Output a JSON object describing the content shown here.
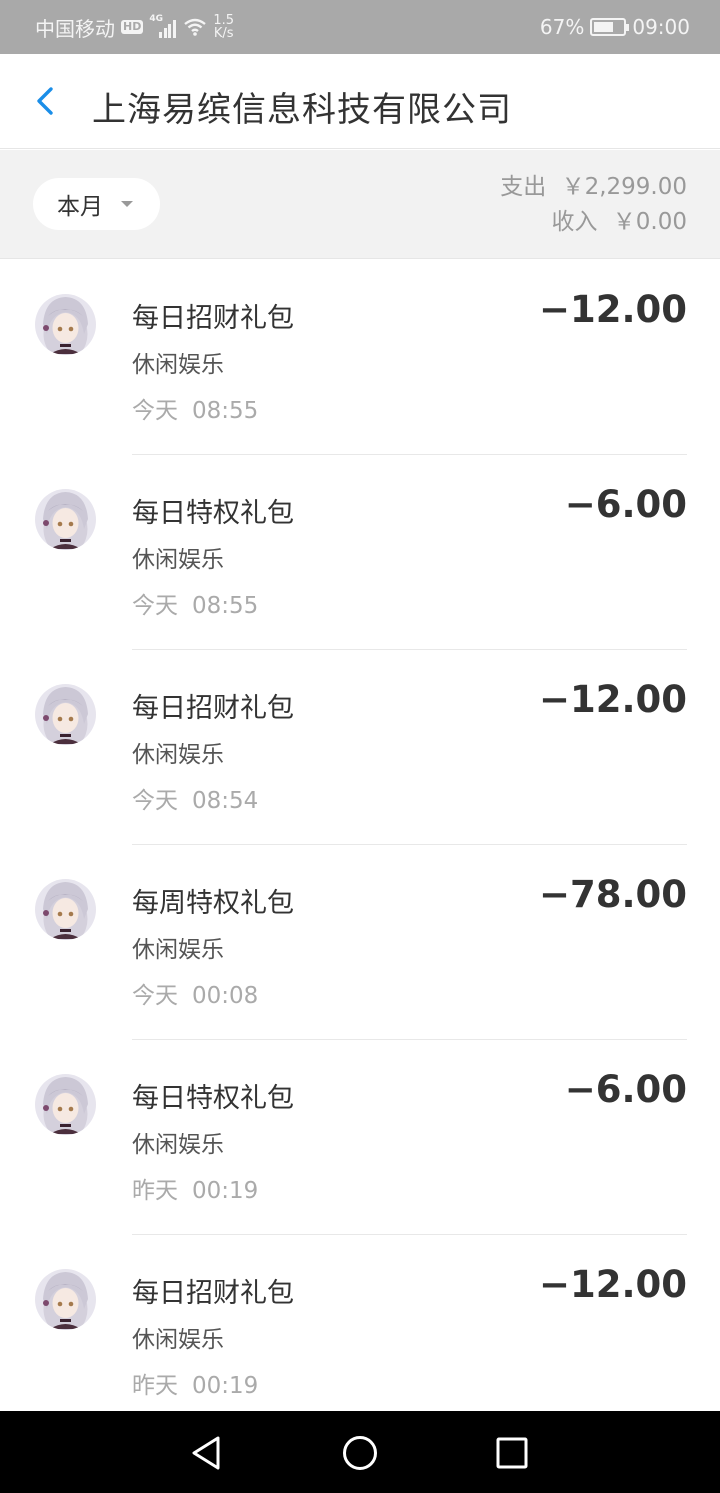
{
  "status_bar": {
    "carrier": "中国移动",
    "hd": "HD",
    "network": "4G",
    "speed_value": "1.5",
    "speed_unit": "K/s",
    "battery_percent": "67%",
    "battery_level": 0.67,
    "time": "09:00"
  },
  "header": {
    "title": "上海易缤信息科技有限公司",
    "back_icon": "chevron-left-icon",
    "accent_color": "#1a8ee8"
  },
  "filter": {
    "period_label": "本月",
    "expense_label": "支出",
    "expense_value": "￥2,299.00",
    "income_label": "收入",
    "income_value": "￥0.00"
  },
  "transactions": [
    {
      "title": "每日招财礼包",
      "category": "休闲娱乐",
      "day": "今天",
      "time": "08:55",
      "amount": "−12.00"
    },
    {
      "title": "每日特权礼包",
      "category": "休闲娱乐",
      "day": "今天",
      "time": "08:55",
      "amount": "−6.00"
    },
    {
      "title": "每日招财礼包",
      "category": "休闲娱乐",
      "day": "今天",
      "time": "08:54",
      "amount": "−12.00"
    },
    {
      "title": "每周特权礼包",
      "category": "休闲娱乐",
      "day": "今天",
      "time": "00:08",
      "amount": "−78.00"
    },
    {
      "title": "每日特权礼包",
      "category": "休闲娱乐",
      "day": "昨天",
      "time": "00:19",
      "amount": "−6.00"
    },
    {
      "title": "每日招财礼包",
      "category": "休闲娱乐",
      "day": "昨天",
      "time": "00:19",
      "amount": "−12.00"
    }
  ],
  "nav": {
    "back_icon": "triangle-back-icon",
    "home_icon": "circle-home-icon",
    "recents_icon": "square-recents-icon"
  }
}
